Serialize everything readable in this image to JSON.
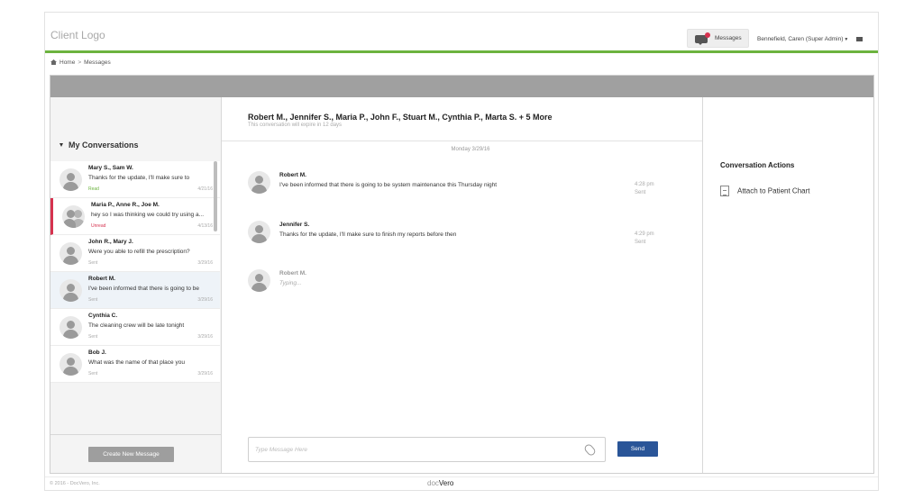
{
  "header": {
    "logo_text": "Client Logo",
    "messages_label": "Messages",
    "user_name": "Bennefield, Caren (Super Admin)"
  },
  "breadcrumb": {
    "home": "Home",
    "separator": ">",
    "current": "Messages"
  },
  "sidebar": {
    "title": "My Conversations",
    "create_button": "Create New Message",
    "conversations": [
      {
        "names": "Mary S., Sam W.",
        "preview": "Thanks for the update, I'll make sure to",
        "status": "Read",
        "date": "4/21/16"
      },
      {
        "names": "Maria P., Anne R., Joe M.",
        "preview": "hey so I was thinking we could try using a...",
        "status": "Unread",
        "date": "4/13/16"
      },
      {
        "names": "John R., Mary J.",
        "preview": "Were you able to refill the prescription?",
        "status": "Sent",
        "date": "3/29/16"
      },
      {
        "names": "Robert M.",
        "preview": "I've been informed that there is going to be",
        "status": "Sent",
        "date": "3/29/16"
      },
      {
        "names": "Cynthia C.",
        "preview": "The cleaning crew will be late tonight",
        "status": "Sent",
        "date": "3/29/16"
      },
      {
        "names": "Bob J.",
        "preview": "What was the name of that place you",
        "status": "Sent",
        "date": "3/29/16"
      }
    ]
  },
  "conversation": {
    "title": "Robert M., Jennifer S., Maria P., John F., Stuart M., Cynthia P., Marta S. + 5 More",
    "expiry_note": "This conversation will expire in 12 days",
    "day_label": "Monday 3/29/16",
    "messages": [
      {
        "sender": "Robert M.",
        "text": "I've been informed that there is going to be system maintenance this Thursday night",
        "time": "4:28 pm",
        "status": "Sent"
      },
      {
        "sender": "Jennifer S.",
        "text": "Thanks for the update, I'll make sure to finish my reports before then",
        "time": "4:29 pm",
        "status": "Sent"
      }
    ],
    "typing": {
      "sender": "Robert M.",
      "text": "Typing..."
    },
    "compose_placeholder": "Type Message Here",
    "send_label": "Send"
  },
  "actions": {
    "title": "Conversation Actions",
    "items": [
      {
        "label": "Attach to Patient Chart",
        "icon": "document-icon"
      }
    ]
  },
  "footer": {
    "copyright": "© 2016 - DocVero, Inc.",
    "brand_prefix": "doc",
    "brand_suffix": "Vero"
  },
  "colors": {
    "accent_green": "#6cb33f",
    "unread_red": "#d6324f",
    "send_blue": "#2a5598"
  }
}
